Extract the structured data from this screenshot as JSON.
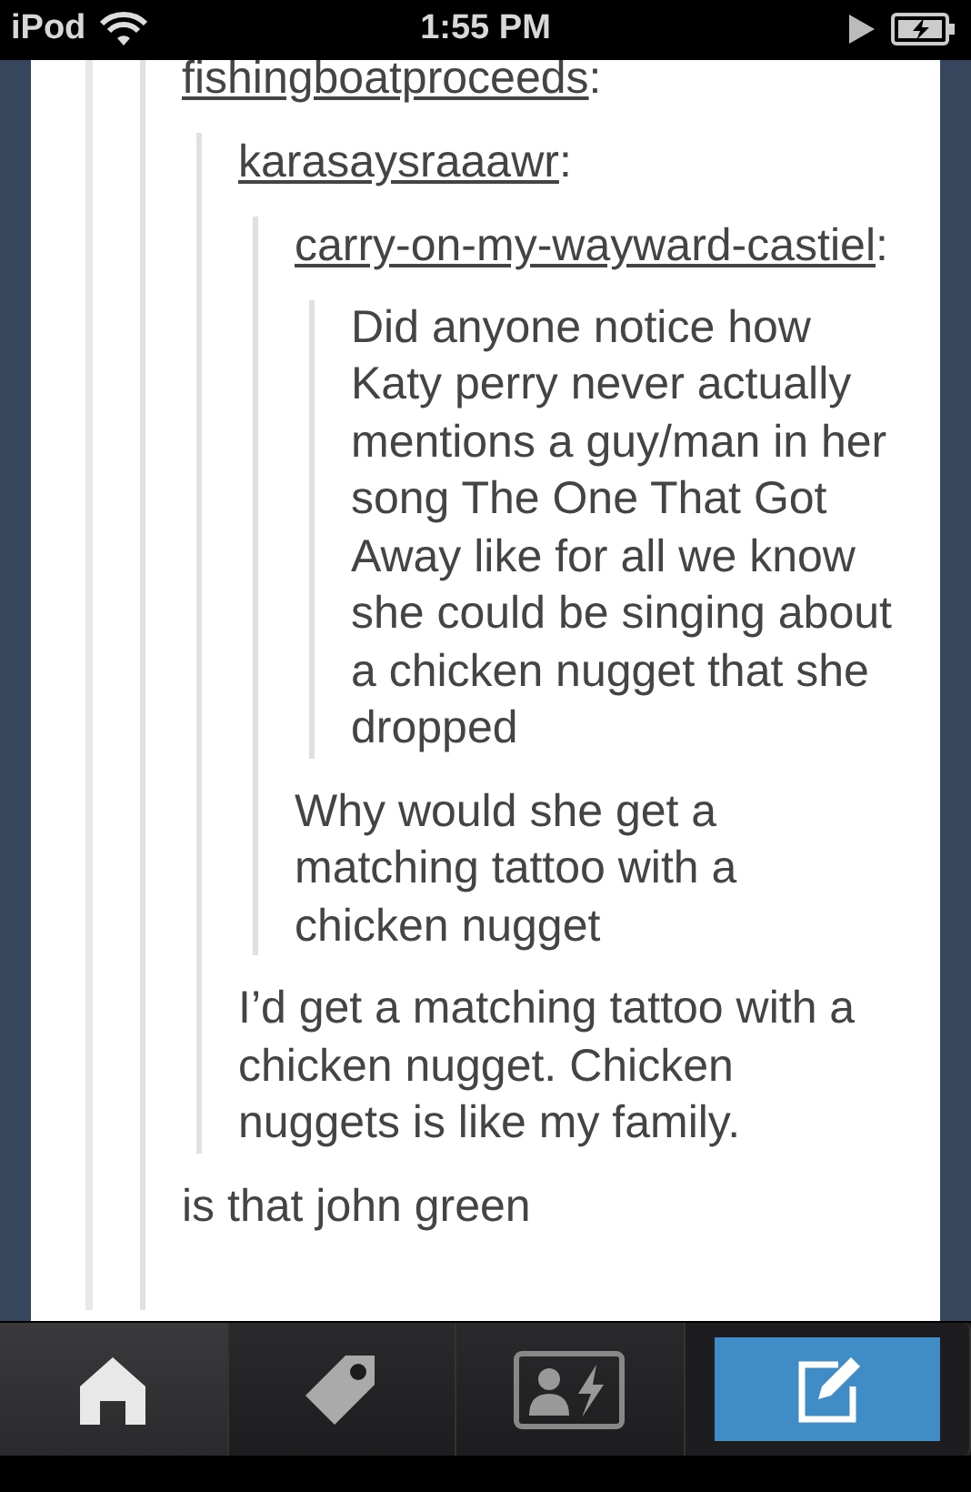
{
  "status_bar": {
    "device": "iPod",
    "time": "1:55 PM"
  },
  "post": {
    "thread": {
      "user": "fishingboatproceeds",
      "separator": ":",
      "quote": {
        "user": "karasaysraaawr",
        "separator": ":",
        "quote": {
          "user": "carry-on-my-wayward-castiel",
          "separator": ":",
          "quote": {
            "text": "Did anyone notice how Katy perry never actually mentions a guy/man in her song The One That Got Away like for all we know she could be singing about a chicken nugget that she dropped"
          },
          "text": "Why would she get a matching tattoo with a chicken nugget"
        },
        "text": "I’d get a matching tattoo with a chicken nugget. Chicken nuggets is like my family."
      },
      "text": "is that john green"
    }
  },
  "tab_bar": [
    {
      "kind": "home",
      "selected": true
    },
    {
      "kind": "tag",
      "selected": false
    },
    {
      "kind": "activity",
      "selected": false
    },
    {
      "kind": "compose",
      "selected": false
    }
  ]
}
